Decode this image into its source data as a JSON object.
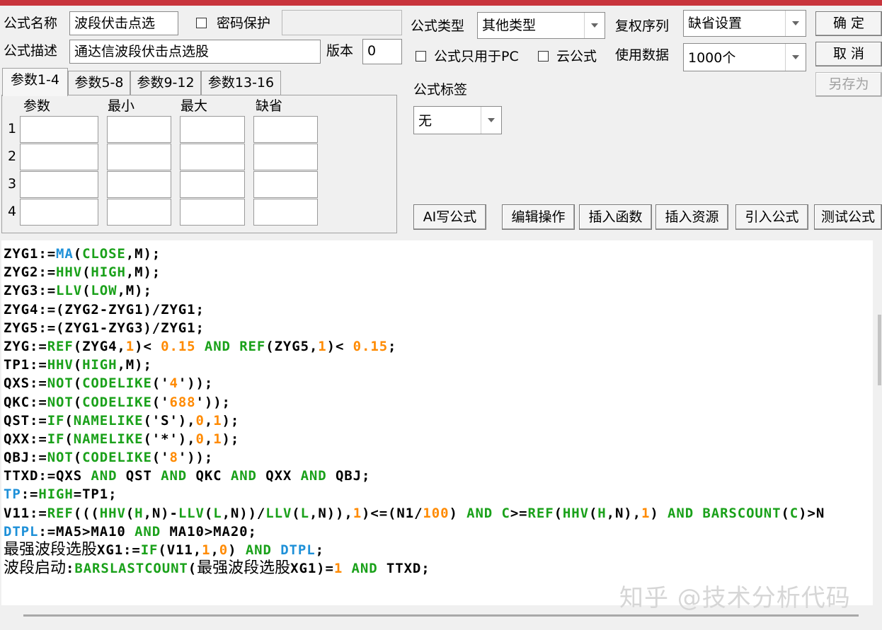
{
  "header": {
    "formula_name_label": "公式名称",
    "formula_name_value": "波段伏击点选",
    "password_label": "密码保护",
    "description_label": "公式描述",
    "description_value": "通达信波段伏击点选股",
    "version_label": "版本",
    "version_value": "0",
    "type_label": "公式类型",
    "type_value": "其他类型",
    "pc_only_label": "公式只用于PC",
    "cloud_label": "云公式",
    "rights_label": "复权序列",
    "rights_value": "缺省设置",
    "data_label": "使用数据",
    "data_value": "1000个",
    "tag_label": "公式标签",
    "tag_value": "无"
  },
  "buttons": {
    "ok": "确 定",
    "cancel": "取 消",
    "save_as": "另存为",
    "ai": "AI写公式",
    "edit": "编辑操作",
    "insert_func": "插入函数",
    "insert_res": "插入资源",
    "import": "引入公式",
    "test": "测试公式"
  },
  "tabs": [
    "参数1-4",
    "参数5-8",
    "参数9-12",
    "参数13-16"
  ],
  "params": {
    "headers": [
      "参数",
      "最小",
      "最大",
      "缺省"
    ],
    "rows": [
      "1",
      "2",
      "3",
      "4"
    ]
  },
  "colors": {
    "plain": "#000000",
    "func": "#1aa11a",
    "number": "#ff8a00",
    "blue": "#1e90d8",
    "accent_bar": "#c8343c"
  },
  "code_lines": [
    [
      [
        "p",
        "ZYG1:="
      ],
      [
        "b",
        "MA"
      ],
      [
        "p",
        "("
      ],
      [
        "g",
        "CLOSE"
      ],
      [
        "p",
        ",M);"
      ]
    ],
    [
      [
        "p",
        "ZYG2:="
      ],
      [
        "g",
        "HHV"
      ],
      [
        "p",
        "("
      ],
      [
        "g",
        "HIGH"
      ],
      [
        "p",
        ",M);"
      ]
    ],
    [
      [
        "p",
        "ZYG3:="
      ],
      [
        "g",
        "LLV"
      ],
      [
        "p",
        "("
      ],
      [
        "g",
        "LOW"
      ],
      [
        "p",
        ",M);"
      ]
    ],
    [
      [
        "p",
        "ZYG4:=(ZYG2-ZYG1)/ZYG1;"
      ]
    ],
    [
      [
        "p",
        "ZYG5:=(ZYG1-ZYG3)/ZYG1;"
      ]
    ],
    [
      [
        "p",
        "ZYG:="
      ],
      [
        "g",
        "REF"
      ],
      [
        "p",
        "(ZYG4,"
      ],
      [
        "o",
        "1"
      ],
      [
        "p",
        ")< "
      ],
      [
        "o",
        "0.15"
      ],
      [
        "g",
        " AND "
      ],
      [
        "g",
        "REF"
      ],
      [
        "p",
        "(ZYG5,"
      ],
      [
        "o",
        "1"
      ],
      [
        "p",
        ")< "
      ],
      [
        "o",
        "0.15"
      ],
      [
        "p",
        ";"
      ]
    ],
    [
      [
        "p",
        "TP1:="
      ],
      [
        "g",
        "HHV"
      ],
      [
        "p",
        "("
      ],
      [
        "g",
        "HIGH"
      ],
      [
        "p",
        ",M);"
      ]
    ],
    [
      [
        "p",
        "QXS:="
      ],
      [
        "g",
        "NOT"
      ],
      [
        "p",
        "("
      ],
      [
        "g",
        "CODELIKE"
      ],
      [
        "p",
        "('"
      ],
      [
        "o",
        "4"
      ],
      [
        "p",
        "'));"
      ]
    ],
    [
      [
        "p",
        "QKC:="
      ],
      [
        "g",
        "NOT"
      ],
      [
        "p",
        "("
      ],
      [
        "g",
        "CODELIKE"
      ],
      [
        "p",
        "('"
      ],
      [
        "o",
        "688"
      ],
      [
        "p",
        "'));"
      ]
    ],
    [
      [
        "p",
        "QST:="
      ],
      [
        "g",
        "IF"
      ],
      [
        "p",
        "("
      ],
      [
        "g",
        "NAMELIKE"
      ],
      [
        "p",
        "('S'),"
      ],
      [
        "o",
        "0"
      ],
      [
        "p",
        ","
      ],
      [
        "o",
        "1"
      ],
      [
        "p",
        ");"
      ]
    ],
    [
      [
        "p",
        "QXX:="
      ],
      [
        "g",
        "IF"
      ],
      [
        "p",
        "("
      ],
      [
        "g",
        "NAMELIKE"
      ],
      [
        "p",
        "('*'),"
      ],
      [
        "o",
        "0"
      ],
      [
        "p",
        ","
      ],
      [
        "o",
        "1"
      ],
      [
        "p",
        ");"
      ]
    ],
    [
      [
        "p",
        "QBJ:="
      ],
      [
        "g",
        "NOT"
      ],
      [
        "p",
        "("
      ],
      [
        "g",
        "CODELIKE"
      ],
      [
        "p",
        "('"
      ],
      [
        "o",
        "8"
      ],
      [
        "p",
        "'));"
      ]
    ],
    [
      [
        "p",
        "TTXD:=QXS "
      ],
      [
        "g",
        "AND"
      ],
      [
        "p",
        " QST "
      ],
      [
        "g",
        "AND"
      ],
      [
        "p",
        " QKC "
      ],
      [
        "g",
        "AND"
      ],
      [
        "p",
        " QXX "
      ],
      [
        "g",
        "AND"
      ],
      [
        "p",
        " QBJ;"
      ]
    ],
    [
      [
        "b",
        "TP"
      ],
      [
        "p",
        ":="
      ],
      [
        "g",
        "HIGH"
      ],
      [
        "p",
        "=TP1;"
      ]
    ],
    [
      [
        "p",
        "V11:="
      ],
      [
        "g",
        "REF"
      ],
      [
        "p",
        "((("
      ],
      [
        "g",
        "HHV"
      ],
      [
        "p",
        "("
      ],
      [
        "g",
        "H"
      ],
      [
        "p",
        ",N)-"
      ],
      [
        "g",
        "LLV"
      ],
      [
        "p",
        "("
      ],
      [
        "g",
        "L"
      ],
      [
        "p",
        ",N))/"
      ],
      [
        "g",
        "LLV"
      ],
      [
        "p",
        "("
      ],
      [
        "g",
        "L"
      ],
      [
        "p",
        ",N)),"
      ],
      [
        "o",
        "1"
      ],
      [
        "p",
        ")<=(N1/"
      ],
      [
        "o",
        "100"
      ],
      [
        "p",
        ") "
      ],
      [
        "g",
        "AND"
      ],
      [
        "p",
        " "
      ],
      [
        "g",
        "C"
      ],
      [
        "p",
        ">="
      ],
      [
        "g",
        "REF"
      ],
      [
        "p",
        "("
      ],
      [
        "g",
        "HHV"
      ],
      [
        "p",
        "("
      ],
      [
        "g",
        "H"
      ],
      [
        "p",
        ",N),"
      ],
      [
        "o",
        "1"
      ],
      [
        "p",
        ") "
      ],
      [
        "g",
        "AND"
      ],
      [
        "p",
        " "
      ],
      [
        "g",
        "BARSCOUNT"
      ],
      [
        "p",
        "("
      ],
      [
        "g",
        "C"
      ],
      [
        "p",
        ")>N"
      ]
    ],
    [
      [
        "b",
        "DTPL"
      ],
      [
        "p",
        ":=MA5>MA10 "
      ],
      [
        "g",
        "AND"
      ],
      [
        "p",
        " MA10>MA20;"
      ]
    ],
    [
      [
        "c",
        "最强波段选股"
      ],
      [
        "p",
        "XG1:="
      ],
      [
        "g",
        "IF"
      ],
      [
        "p",
        "(V11,"
      ],
      [
        "o",
        "1"
      ],
      [
        "p",
        ","
      ],
      [
        "o",
        "0"
      ],
      [
        "p",
        ") "
      ],
      [
        "g",
        "AND"
      ],
      [
        "p",
        " "
      ],
      [
        "b",
        "DTPL"
      ],
      [
        "p",
        ";"
      ]
    ],
    [
      [
        "c",
        "波段启动"
      ],
      [
        "p",
        ":"
      ],
      [
        "g",
        "BARSLASTCOUNT"
      ],
      [
        "p",
        "("
      ],
      [
        "c",
        "最强波段选股"
      ],
      [
        "p",
        "XG1)="
      ],
      [
        "o",
        "1"
      ],
      [
        "p",
        " "
      ],
      [
        "g",
        "AND"
      ],
      [
        "p",
        " TTXD;"
      ]
    ]
  ],
  "watermark": "知乎 @技术分析代码"
}
